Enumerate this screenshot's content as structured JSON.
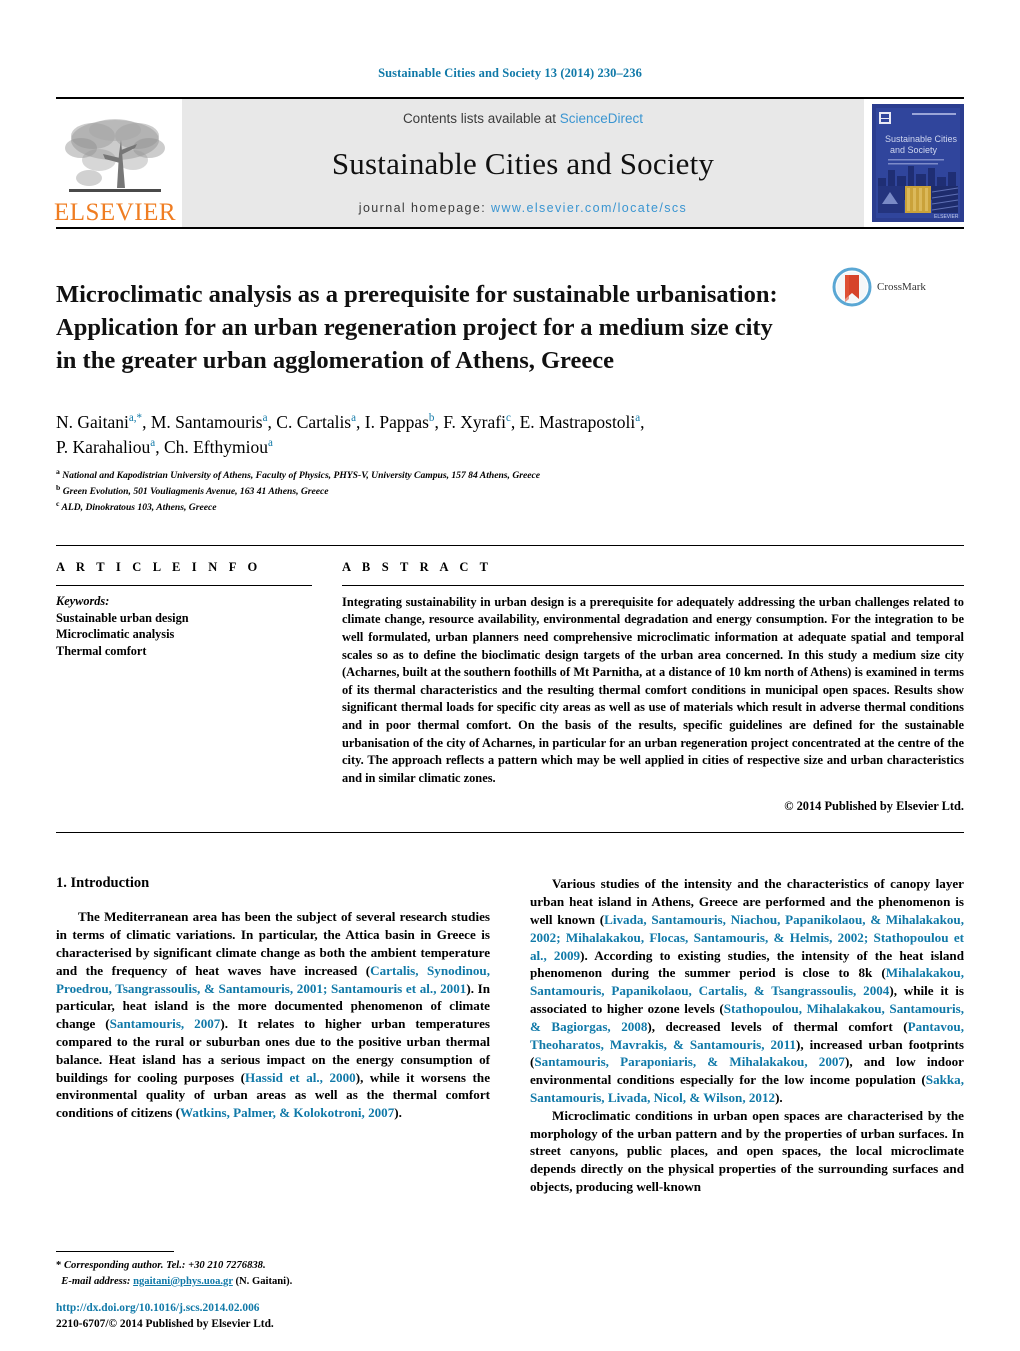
{
  "running_head": "Sustainable Cities and Society 13 (2014) 230–236",
  "masthead": {
    "publisher_name": "ELSEVIER",
    "contents_prefix": "Contents lists available at ",
    "contents_link": "ScienceDirect",
    "journal_name": "Sustainable Cities and Society",
    "homepage_prefix": "journal homepage: ",
    "homepage_url": "www.elsevier.com/locate/scs",
    "cover_title_line1": "Sustainable Cities",
    "cover_title_line2": "and Society"
  },
  "article": {
    "title_line1": "Microclimatic analysis as a prerequisite for sustainable urbanisation:",
    "title_line2": "Application for an urban regeneration project for a medium size city",
    "title_line3": "in the greater urban agglomeration of Athens, Greece",
    "crossmark_label": "CrossMark",
    "authors": [
      {
        "name": "N. Gaitani",
        "marks": "a,*"
      },
      {
        "name": "M. Santamouris",
        "marks": "a"
      },
      {
        "name": "C. Cartalis",
        "marks": "a"
      },
      {
        "name": "I. Pappas",
        "marks": "b"
      },
      {
        "name": "F. Xyrafi",
        "marks": "c"
      },
      {
        "name": "E. Mastrapostoli",
        "marks": "a"
      },
      {
        "name": "P. Karahaliou",
        "marks": "a"
      },
      {
        "name": "Ch. Efthymiou",
        "marks": "a"
      }
    ],
    "affiliations": [
      {
        "mark": "a",
        "text": "National and Kapodistrian University of Athens, Faculty of Physics, PHYS-V, University Campus, 157 84 Athens, Greece"
      },
      {
        "mark": "b",
        "text": "Green Evolution, 501 Vouliagmenis Avenue, 163 41 Athens, Greece"
      },
      {
        "mark": "c",
        "text": "ALD, Dinokratous 103, Athens, Greece"
      }
    ]
  },
  "article_info": {
    "heading": "A R T I C L E   I N F O",
    "keywords_label": "Keywords:",
    "keywords": [
      "Sustainable urban design",
      "Microclimatic analysis",
      "Thermal comfort"
    ]
  },
  "abstract": {
    "heading": "A B S T R A C T",
    "text": "Integrating sustainability in urban design is a prerequisite for adequately addressing the urban challenges related to climate change, resource availability, environmental degradation and energy consumption. For the integration to be well formulated, urban planners need comprehensive microclimatic information at adequate spatial and temporal scales so as to define the bioclimatic design targets of the urban area concerned. In this study a medium size city (Acharnes, built at the southern foothills of Mt Parnitha, at a distance of 10 km north of Athens) is examined in terms of its thermal characteristics and the resulting thermal comfort conditions in municipal open spaces. Results show significant thermal loads for specific city areas as well as use of materials which result in adverse thermal conditions and in poor thermal comfort. On the basis of the results, specific guidelines are defined for the sustainable urbanisation of the city of Acharnes, in particular for an urban regeneration project concentrated at the centre of the city. The approach reflects a pattern which may be well applied in cities of respective size and urban characteristics and in similar climatic zones.",
    "copyright": "© 2014 Published by Elsevier Ltd."
  },
  "introduction": {
    "heading": "1.  Introduction",
    "left_para_1_a": "The Mediterranean area has been the subject of several research studies in terms of climatic variations. In particular, the Attica basin in Greece is characterised by significant climate change as both the ambient temperature and the frequency of heat waves have increased (",
    "left_para_1_ref1": "Cartalis, Synodinou, Proedrou, Tsangrassoulis, & Santamouris, 2001; Santamouris et al., 2001",
    "left_para_1_b": "). In particular, heat island is the more documented phenomenon of climate change (",
    "left_para_1_ref2": "Santamouris, 2007",
    "left_para_1_c": "). It relates to higher urban temperatures compared to the rural or suburban ones due to the positive urban thermal balance. Heat island has a serious impact on the energy consumption of buildings for cooling purposes (",
    "left_para_1_ref3": "Hassid et al., 2000",
    "left_para_1_d": "), while it worsens the environmental quality of urban areas as well as the thermal comfort conditions of citizens (",
    "left_para_1_ref4": "Watkins, Palmer, & Kolokotroni, 2007",
    "left_para_1_e": ").",
    "right_para_1_a": "Various studies of the intensity and the characteristics of canopy layer urban heat island in Athens, Greece are performed and the phenomenon is well known (",
    "right_para_1_ref1": "Livada, Santamouris, Niachou, Papanikolaou, & Mihalakakou, 2002; Mihalakakou, Flocas, Santamouris, & Helmis, 2002; Stathopoulou et al., 2009",
    "right_para_1_b": "). According to existing studies, the intensity of the heat island phenomenon during the summer period is close to 8k (",
    "right_para_1_ref2": "Mihalakakou, Santamouris, Papanikolaou, Cartalis, & Tsangrassoulis, 2004",
    "right_para_1_c": "), while it is associated to higher ozone levels (",
    "right_para_1_ref3": "Stathopoulou, Mihalakakou, Santamouris, & Bagiorgas, 2008",
    "right_para_1_d": "), decreased levels of thermal comfort (",
    "right_para_1_ref4": "Pantavou, Theoharatos, Mavrakis, & Santamouris, 2011",
    "right_para_1_e": "), increased urban footprints (",
    "right_para_1_ref5": "Santamouris, Paraponiaris, & Mihalakakou, 2007",
    "right_para_1_f": "), and low indoor environmental conditions especially for the low income population (",
    "right_para_1_ref6": "Sakka, Santamouris, Livada, Nicol, & Wilson, 2012",
    "right_para_1_g": ").",
    "right_para_2": "Microclimatic conditions in urban open spaces are characterised by the morphology of the urban pattern and by the properties of urban surfaces. In street canyons, public places, and open spaces, the local microclimate depends directly on the physical properties of the surrounding surfaces and objects, producing well-known"
  },
  "footer": {
    "corresponding_star": "*",
    "corresponding_text": "Corresponding author. Tel.: +30 210 7276838.",
    "email_label": "E-mail address:",
    "email_address": "ngaitani@phys.uoa.gr",
    "email_suffix": " (N. Gaitani).",
    "doi": "http://dx.doi.org/10.1016/j.scs.2014.02.006",
    "issn_line": "2210-6707/© 2014 Published by Elsevier Ltd."
  },
  "colors": {
    "link_blue": "#1079a8",
    "sciencedirect_blue": "#3a95d1",
    "elsevier_orange": "#ef7d22",
    "banner_gray": "#e8e8e8"
  }
}
